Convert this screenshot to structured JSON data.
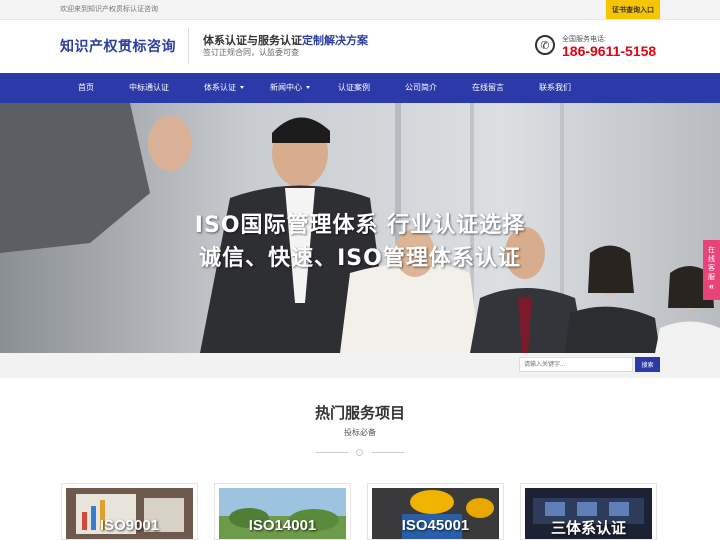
{
  "topbar": {
    "welcome": "欢迎来到知识产权贯标认证咨询",
    "cert_button": "证书查询入口"
  },
  "header": {
    "logo": "知识产权贯标咨询",
    "slogan_main": "体系认证与服务认证",
    "slogan_highlight": "定制解决方案",
    "slogan_sub": "签订正规合同，认监委可查",
    "phone_label": "全国服务电话:",
    "phone_number": "186-9611-5158"
  },
  "nav": {
    "items": [
      {
        "label": "首页",
        "has_dropdown": false
      },
      {
        "label": "中标通认证",
        "has_dropdown": false
      },
      {
        "label": "体系认证",
        "has_dropdown": true
      },
      {
        "label": "新闻中心",
        "has_dropdown": true
      },
      {
        "label": "认证案例",
        "has_dropdown": false
      },
      {
        "label": "公司简介",
        "has_dropdown": false
      },
      {
        "label": "在线留言",
        "has_dropdown": false
      },
      {
        "label": "联系我们",
        "has_dropdown": false
      }
    ]
  },
  "banner": {
    "line1": "ISO国际管理体系  行业认证选择",
    "line2": "诚信、快速、ISO管理体系认证"
  },
  "side_float": {
    "label": "在线客服",
    "chevron": "«"
  },
  "search": {
    "placeholder": "请输入关键字...",
    "button": "搜索"
  },
  "section": {
    "title": "热门服务项目",
    "subtitle": "投标必备"
  },
  "cards": [
    {
      "label": "ISO9001"
    },
    {
      "label": "ISO14001"
    },
    {
      "label": "ISO45001"
    },
    {
      "label": "三体系认证"
    }
  ],
  "colors": {
    "brand_blue": "#2b3aa8",
    "accent_yellow": "#f7c500",
    "phone_red": "#e60012",
    "side_pink": "#e8447a"
  }
}
